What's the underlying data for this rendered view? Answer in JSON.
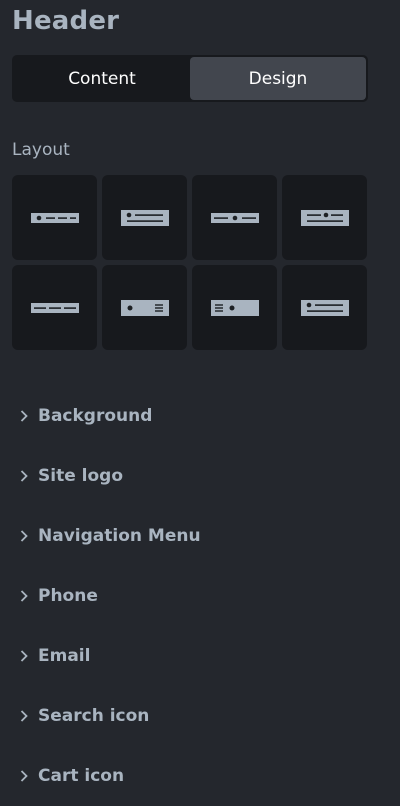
{
  "panel": {
    "title": "Header"
  },
  "tabs": [
    {
      "label": "Content",
      "active": false
    },
    {
      "label": "Design",
      "active": true
    }
  ],
  "layout": {
    "label": "Layout",
    "options": [
      {
        "icon": "layout-bar-dot-left-icon"
      },
      {
        "icon": "layout-box-dot-left-icon"
      },
      {
        "icon": "layout-line-dot-center-icon"
      },
      {
        "icon": "layout-box-dot-right-icon"
      },
      {
        "icon": "layout-line-dashes-icon"
      },
      {
        "icon": "layout-box-dot-lines-right-icon"
      },
      {
        "icon": "layout-box-lines-dot-left-icon"
      },
      {
        "icon": "layout-box-dot-lines-icon"
      }
    ]
  },
  "accordion": [
    {
      "label": "Background",
      "icon": "chevron-right-icon"
    },
    {
      "label": "Site logo",
      "icon": "chevron-right-icon"
    },
    {
      "label": "Navigation Menu",
      "icon": "chevron-right-icon"
    },
    {
      "label": "Phone",
      "icon": "chevron-right-icon"
    },
    {
      "label": "Email",
      "icon": "chevron-right-icon"
    },
    {
      "label": "Search icon",
      "icon": "chevron-right-icon"
    },
    {
      "label": "Cart icon",
      "icon": "chevron-right-icon"
    }
  ],
  "colors": {
    "background": "#24272d",
    "tile": "#17191d",
    "active_tab": "#42464e",
    "text": "#a9b4c0",
    "glyph": "#a9b4c0",
    "glyph_mark": "#1d2024"
  }
}
